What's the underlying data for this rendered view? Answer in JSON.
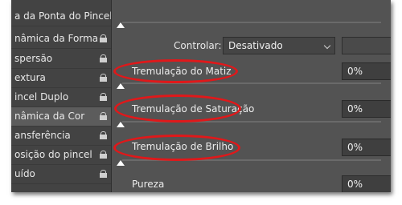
{
  "list": {
    "items": [
      {
        "label": "a da Ponta do Pincel",
        "locked": false,
        "selected": false
      },
      {
        "label": "nâmica da Forma",
        "locked": true,
        "selected": false
      },
      {
        "label": "spersão",
        "locked": true,
        "selected": false
      },
      {
        "label": "extura",
        "locked": true,
        "selected": false
      },
      {
        "label": "incel Duplo",
        "locked": true,
        "selected": false
      },
      {
        "label": "nâmica da Cor",
        "locked": true,
        "selected": true
      },
      {
        "label": "ansferência",
        "locked": true,
        "selected": false
      },
      {
        "label": "osição do pincel",
        "locked": true,
        "selected": false
      },
      {
        "label": "uído",
        "locked": true,
        "selected": false
      }
    ]
  },
  "control": {
    "label": "Controlar:",
    "value": "Desativado"
  },
  "rows": [
    {
      "label": "Tremulação do Matiz",
      "value": "0%"
    },
    {
      "label": "Tremulação de Saturação",
      "value": "0%"
    },
    {
      "label": "Tremulação de Brilho",
      "value": "0%"
    },
    {
      "label": "Pureza",
      "value": "0%"
    }
  ],
  "colors": {
    "highlight": "#e0181a",
    "panel": "#535353",
    "list": "#434343"
  }
}
